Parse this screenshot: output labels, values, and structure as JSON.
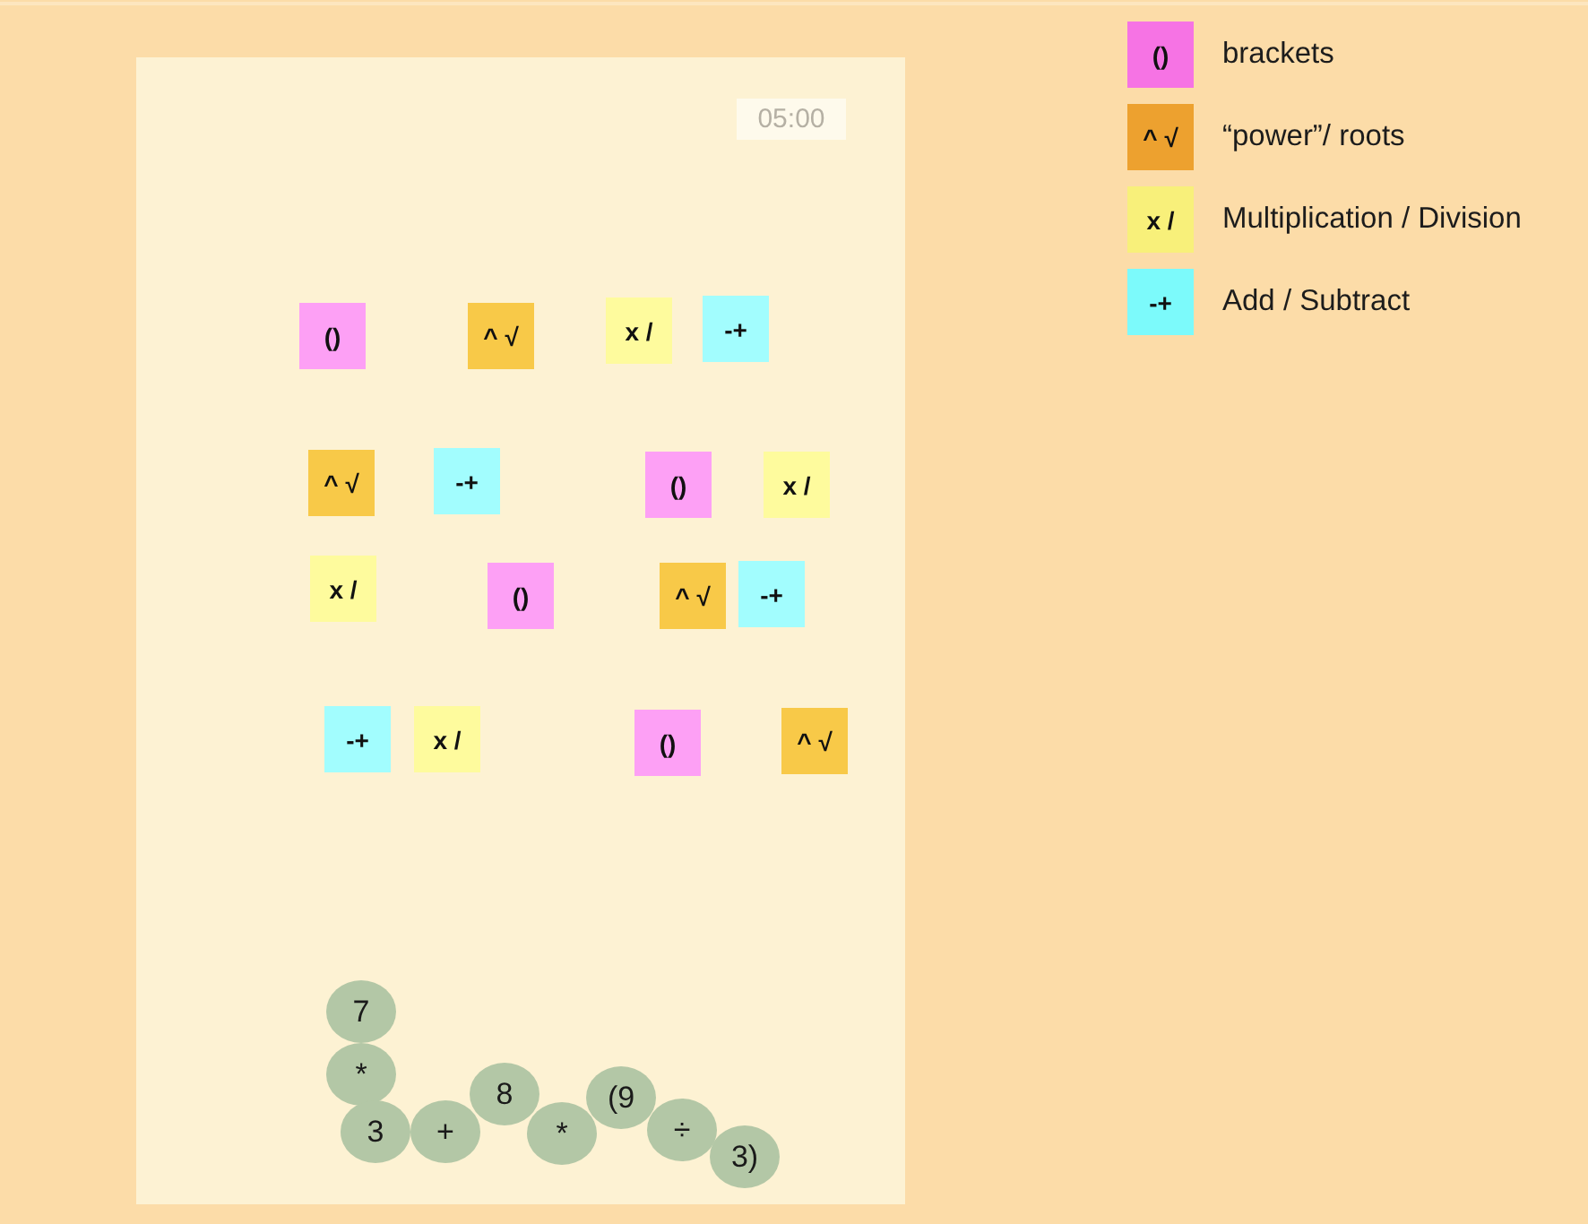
{
  "board": {
    "timer": "05:00",
    "tiles": [
      {
        "symbol": "()",
        "color": "#fda0f5"
      },
      {
        "symbol": "^ √",
        "color": "#f8c948"
      },
      {
        "symbol": "x /",
        "color": "#fefb9d"
      },
      {
        "symbol": "-+",
        "color": "#a2fdfe"
      },
      {
        "symbol": "^ √",
        "color": "#f8c948"
      },
      {
        "symbol": "-+",
        "color": "#a2fdfe"
      },
      {
        "symbol": "()",
        "color": "#fda0f5"
      },
      {
        "symbol": "x /",
        "color": "#fefb9d"
      },
      {
        "symbol": "x /",
        "color": "#fefb9d"
      },
      {
        "symbol": "()",
        "color": "#fda0f5"
      },
      {
        "symbol": "^ √",
        "color": "#f8c948"
      },
      {
        "symbol": "-+",
        "color": "#a2fdfe"
      },
      {
        "symbol": "-+",
        "color": "#a2fdfe"
      },
      {
        "symbol": "x /",
        "color": "#fefb9d"
      },
      {
        "symbol": "()",
        "color": "#fda0f5"
      },
      {
        "symbol": "^ √",
        "color": "#f8c948"
      }
    ],
    "expression": [
      "7",
      "*",
      "3",
      "+",
      "8",
      "*",
      "(9",
      "÷",
      "3)"
    ]
  },
  "legend": [
    {
      "symbol": "()",
      "label": "brackets",
      "color": "#f673e4"
    },
    {
      "symbol": "^ √",
      "label": "“power”/ roots",
      "color": "#eda12f"
    },
    {
      "symbol": "x /",
      "label": "Multiplication / Division",
      "color": "#f8f07a"
    },
    {
      "symbol": "-+",
      "label": "Add / Subtract",
      "color": "#7cfafb"
    }
  ]
}
